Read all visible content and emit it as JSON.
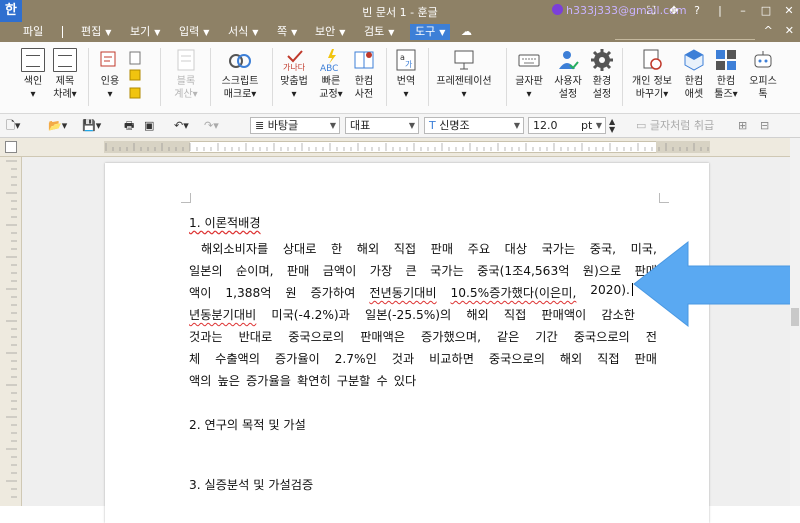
{
  "titlebar": {
    "app_icon": "한",
    "title": "빈 문서 1 - 훈글",
    "account": "h333j333@gmail.com",
    "buttons": [
      "⛶",
      "✥",
      "?",
      "|",
      "–",
      "□",
      "✕"
    ]
  },
  "menubar": {
    "file": "파일",
    "items": [
      {
        "label": "편집",
        "active": false
      },
      {
        "label": "보기",
        "active": false
      },
      {
        "label": "입력",
        "active": false
      },
      {
        "label": "서식",
        "active": false
      },
      {
        "label": "쪽",
        "active": false
      },
      {
        "label": "보안",
        "active": false
      },
      {
        "label": "검토",
        "active": false
      },
      {
        "label": "도구",
        "active": true
      }
    ],
    "right_buttons": [
      "^",
      "✕"
    ]
  },
  "ribbon": {
    "items": [
      {
        "line1": "색인",
        "line2": "▾",
        "icon": "index-icon",
        "dim": false
      },
      {
        "line1": "제목",
        "line2": "차례▾",
        "icon": "table-of-contents-icon",
        "dim": false
      },
      {
        "line1": "인용",
        "line2": "▾",
        "icon": "citation-icon",
        "dim": false
      },
      {
        "line1": "블록",
        "line2": "계산▾",
        "icon": "block-calc-icon",
        "dim": true
      },
      {
        "line1": "스크립트",
        "line2": "매크로▾",
        "icon": "script-macro-icon",
        "dim": false
      },
      {
        "line1": "맞춤법",
        "line2": "▾",
        "icon": "spellcheck-icon",
        "dim": false
      },
      {
        "line1": "빠른",
        "line2": "교정▾",
        "icon": "quick-correct-icon",
        "dim": false
      },
      {
        "line1": "한컴",
        "line2": "사전",
        "icon": "dictionary-icon",
        "dim": false
      },
      {
        "line1": "번역",
        "line2": "▾",
        "icon": "translate-icon",
        "dim": false
      },
      {
        "line1": "프레젠테이션",
        "line2": "▾",
        "icon": "presentation-icon",
        "dim": false
      },
      {
        "line1": "글자판",
        "line2": "▾",
        "icon": "keyboard-icon",
        "dim": false
      },
      {
        "line1": "사용자",
        "line2": "설정",
        "icon": "user-settings-icon",
        "dim": false
      },
      {
        "line1": "환경",
        "line2": "설정",
        "icon": "gear-icon",
        "dim": false
      },
      {
        "line1": "개인 정보",
        "line2": "바꾸기▾",
        "icon": "privacy-icon",
        "dim": false
      },
      {
        "line1": "한컴",
        "line2": "애셋",
        "icon": "asset-icon",
        "dim": false
      },
      {
        "line1": "한컴",
        "line2": "툴즈▾",
        "icon": "tools-icon",
        "dim": false
      },
      {
        "line1": "오피스",
        "line2": "톡",
        "icon": "office-talk-icon",
        "dim": false
      }
    ]
  },
  "formatbar": {
    "style": "바탕글",
    "language": "대표",
    "font": "신명조",
    "size": "12.0",
    "unit": "pt",
    "char_label": "글자처럼 취급"
  },
  "document": {
    "heading1": "1. 이론적배경",
    "para_lines": [
      [
        "해외소비자를",
        "상대로",
        "한",
        "해외",
        "직접",
        "판매",
        "주요",
        "대상",
        "국가는",
        "중국,",
        "미국,"
      ],
      [
        "일본의",
        "순이며,",
        "판매",
        "금액이",
        "가장",
        "큰",
        "국가는",
        "중국(1조4,563억",
        "원)으로",
        "판매"
      ],
      [
        "액이",
        "1,388억",
        "원",
        "증가하여",
        "전년동기대비",
        "10.5%증가했다(이은미,",
        "2020)."
      ],
      [
        "년동분기대비",
        "미국(-4.2%)과",
        "일본(-25.5%)의",
        "해외",
        "직접",
        "판매액이",
        "감소한"
      ],
      [
        "것과는",
        "반대로",
        "중국으로의",
        "판매액은",
        "증가했으며,",
        "같은",
        "기간",
        "중국으로의",
        "전"
      ],
      [
        "체",
        "수출액의",
        "증가율이",
        "2.7%인",
        "것과",
        "비교하면",
        "중국으로의",
        "해외",
        "직접",
        "판매"
      ],
      [
        "액의",
        "높은",
        "증가율을",
        "확연히",
        "구분할",
        "수",
        "있다"
      ]
    ],
    "heading2": "2. 연구의 목적 및 가설",
    "heading3": "3. 실증분석 및 가설검증"
  },
  "colors": {
    "titlebar_bg": "#8e8166",
    "active_menu": "#3d7fd7",
    "arrow": "#5aa9f2",
    "spell_underline": "#d33333"
  }
}
